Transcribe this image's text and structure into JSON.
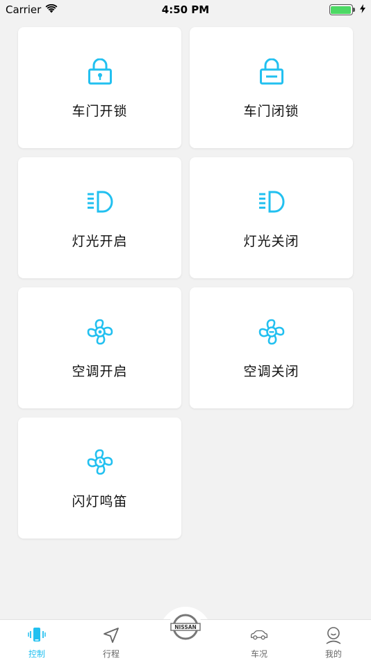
{
  "status_bar": {
    "carrier": "Carrier",
    "time": "4:50 PM"
  },
  "colors": {
    "accent": "#22c0f0",
    "background": "#f2f2f2",
    "card": "#ffffff",
    "battery": "#4cd964"
  },
  "controls": [
    {
      "label": "车门开锁",
      "icon": "lock-open-icon"
    },
    {
      "label": "车门闭锁",
      "icon": "lock-closed-icon"
    },
    {
      "label": "灯光开启",
      "icon": "headlight-icon"
    },
    {
      "label": "灯光关闭",
      "icon": "headlight-icon"
    },
    {
      "label": "空调开启",
      "icon": "fan-icon"
    },
    {
      "label": "空调关闭",
      "icon": "fan-off-icon"
    },
    {
      "label": "闪灯鸣笛",
      "icon": "fan-timer-icon"
    }
  ],
  "tabs": [
    {
      "label": "控制",
      "icon": "phone-vibrate-icon",
      "active": true
    },
    {
      "label": "行程",
      "icon": "navigation-icon",
      "active": false
    },
    {
      "label": "车况",
      "icon": "car-icon",
      "active": false
    },
    {
      "label": "我的",
      "icon": "profile-icon",
      "active": false
    }
  ],
  "center_logo": {
    "text": "NISSAN",
    "icon": "nissan-logo-icon"
  }
}
